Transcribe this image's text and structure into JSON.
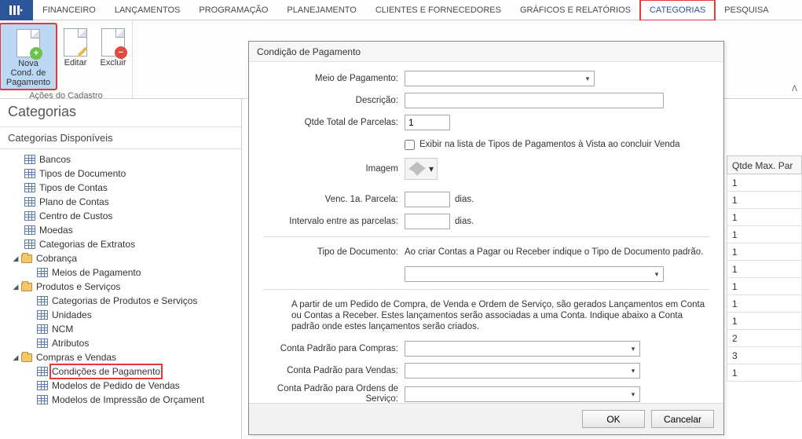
{
  "menu": {
    "tabs": [
      "FINANCEIRO",
      "LANÇAMENTOS",
      "PROGRAMAÇÃO",
      "PLANEJAMENTO",
      "CLIENTES E FORNECEDORES",
      "GRÁFICOS E RELATÓRIOS",
      "CATEGORIAS",
      "PESQUISA"
    ],
    "active": "CATEGORIAS"
  },
  "ribbon": {
    "btn_new": "Nova Cond. de Pagamento",
    "btn_edit": "Editar",
    "btn_delete": "Excluir",
    "group_title": "Ações do Cadastro"
  },
  "sidebar": {
    "title": "Categorias",
    "subtitle": "Categorias Disponíveis",
    "items": [
      {
        "type": "leaf",
        "label": "Bancos"
      },
      {
        "type": "leaf",
        "label": "Tipos de Documento"
      },
      {
        "type": "leaf",
        "label": "Tipos de Contas"
      },
      {
        "type": "leaf",
        "label": "Plano de Contas"
      },
      {
        "type": "leaf",
        "label": "Centro de Custos"
      },
      {
        "type": "leaf",
        "label": "Moedas"
      },
      {
        "type": "leaf",
        "label": "Categorias de Extratos"
      },
      {
        "type": "folder",
        "label": "Cobrança"
      },
      {
        "type": "child",
        "label": "Meios de Pagamento"
      },
      {
        "type": "folder",
        "label": "Produtos e Serviços"
      },
      {
        "type": "child",
        "label": "Categorias de Produtos e Serviços"
      },
      {
        "type": "child",
        "label": "Unidades"
      },
      {
        "type": "child",
        "label": "NCM"
      },
      {
        "type": "child",
        "label": "Atributos"
      },
      {
        "type": "folder",
        "label": "Compras e Vendas"
      },
      {
        "type": "child",
        "label": "Condições de Pagamento",
        "hl": true
      },
      {
        "type": "child",
        "label": "Modelos de Pedido de Vendas"
      },
      {
        "type": "child",
        "label": "Modelos de Impressão de Orçament"
      }
    ]
  },
  "grid": {
    "header": "Qtde Max. Par",
    "rows": [
      "1",
      "1",
      "1",
      "1",
      "1",
      "1",
      "1",
      "1",
      "1",
      "2",
      "3",
      "1"
    ]
  },
  "dialog": {
    "title": "Condição de Pagamento",
    "lbl_meio": "Meio de Pagamento:",
    "lbl_desc": "Descrição:",
    "lbl_qtde": "Qtde Total de Parcelas:",
    "val_qtde": "1",
    "chk_exibir": "Exibir na lista de Tipos de Pagamentos à Vista ao concluir Venda",
    "lbl_imagem": "Imagem",
    "lbl_venc": "Venc. 1a. Parcela:",
    "lbl_intervalo": "Intervalo entre as parcelas:",
    "txt_dias": "dias.",
    "lbl_tipodoc": "Tipo de Documento:",
    "hint_tipodoc": "Ao criar Contas a Pagar ou Receber indique  o Tipo de Documento padrão.",
    "help_text": "A partir de um Pedido de Compra, de Venda e Ordem de Serviço, são gerados Lançamentos em Conta ou Contas a Receber. Estes lançamentos serão associadas a uma Conta. Indique abaixo a Conta padrão onde estes lançamentos serão criados.",
    "lbl_conta_compras": "Conta Padrão para Compras:",
    "lbl_conta_vendas": "Conta Padrão para Vendas:",
    "lbl_conta_ordens": "Conta Padrão para Ordens de Serviço:",
    "btn_ok": "OK",
    "btn_cancel": "Cancelar"
  }
}
